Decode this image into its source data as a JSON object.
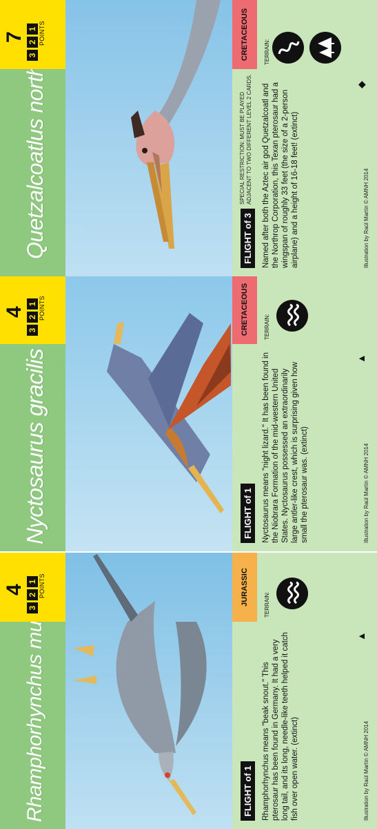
{
  "cards": [
    {
      "title": "Rhamphorhynchus muensteri",
      "points": "4",
      "points_label": "POINTS",
      "steps": [
        "3",
        "2",
        "1"
      ],
      "period": "JURASSIC",
      "flight": "FLIGHT of 1",
      "description": "Rhamphorhynchus means \"beak snout.\" This pterosaur has been found in Germany. It had a very long tail, and its long, needle-like teeth helped it catch fish over open water. (extinct)",
      "terrain_label": "TERRAIN:",
      "terrain_icons": [
        "ocean-wave-icon"
      ],
      "credit": "Illustration by Raúl Martín © AMNH 2014",
      "marker": "▲"
    },
    {
      "title": "Nyctosaurus gracilis",
      "points": "4",
      "points_label": "POINTS",
      "steps": [
        "3",
        "2",
        "1"
      ],
      "period": "CRETACEOUS",
      "flight": "FLIGHT of 1",
      "description": "Nyctosaurus means \"night lizard.\" It has been found in the Niobrara Formation of the mid-western United States. Nyctosaurus possessed an extraordinarily large antler-like crest, which is surprising given how small the pterosaur was. (extinct)",
      "terrain_label": "TERRAIN:",
      "terrain_icons": [
        "ocean-wave-icon"
      ],
      "credit": "Illustration by Raúl Martín © AMNH 2014",
      "marker": "▲"
    },
    {
      "title": "Quetzalcoatlus northropi",
      "points": "7",
      "points_label": "POINTS",
      "steps": [
        "3",
        "2",
        "1"
      ],
      "period": "CRETACEOUS",
      "flight": "FLIGHT of 3",
      "restriction": "SPECIAL RESTRICTION: MUST BE PLAYED ADJACENT TO TWO DIFFERENT LEVEL 2 CARDS.",
      "description": "Named after both the Aztec air god Quetzalcoatl and the Northrop Corporation, this Texan pterosaur had a wingspan of roughly 33 feet (the size of a 2-person airplane) and a height of 16-18 feet! (extinct)",
      "terrain_label": "TERRAIN:",
      "terrain_icons": [
        "river-icon",
        "forest-icon"
      ],
      "credit": "Illustration by Raúl Martín © AMNH 2014",
      "marker": "◆"
    }
  ],
  "colors": {
    "card_green": "#8ec77d",
    "panel_green": "#c9e6bb",
    "points_yellow": "#ffe000",
    "jurassic_orange": "#f6b14a",
    "cretaceous_red": "#ef6b72"
  }
}
